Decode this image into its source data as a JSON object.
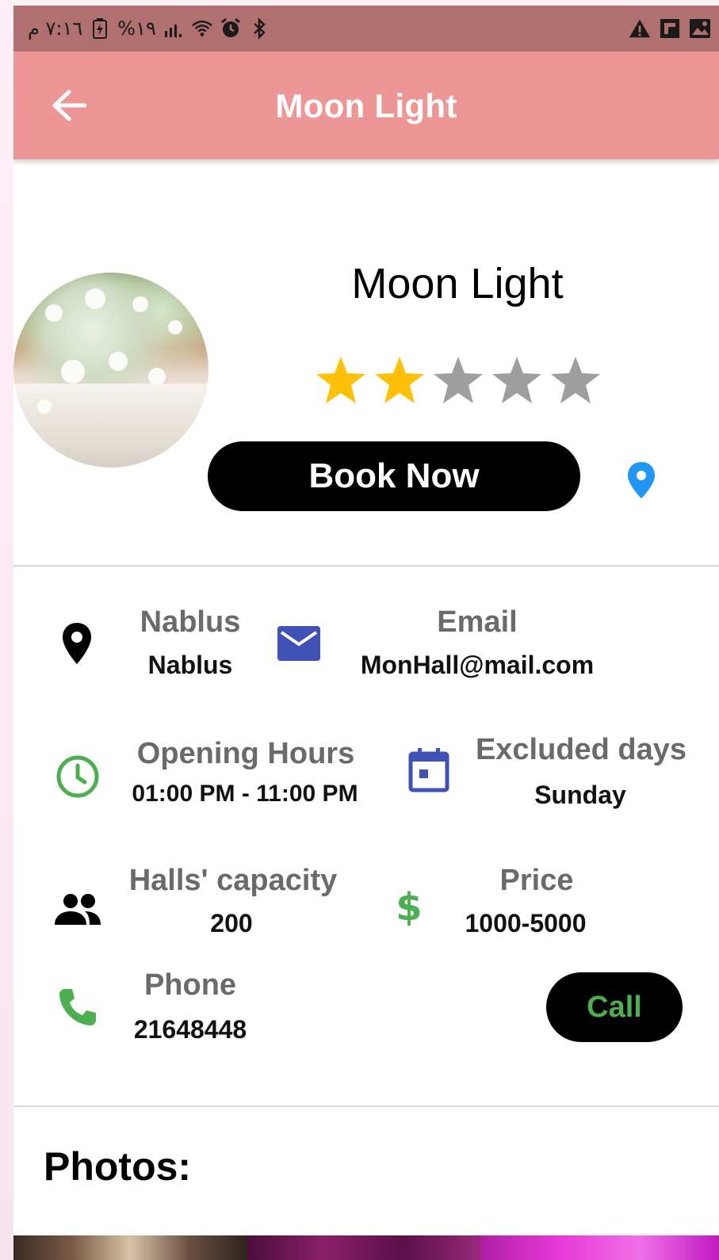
{
  "status_bar": {
    "time": "٧:١٦ م",
    "battery": "%١٩",
    "icons_left": [
      "battery-icon",
      "signal-icon",
      "wifi-icon",
      "alarm-icon",
      "bluetooth-icon"
    ],
    "icons_right": [
      "warning-icon",
      "flipboard-icon",
      "gallery-icon"
    ]
  },
  "app_bar": {
    "title": "Moon Light",
    "back_icon": "arrow-left-icon"
  },
  "hall": {
    "name": "Moon Light",
    "rating": 2,
    "rating_max": 5,
    "book_label": "Book Now"
  },
  "info": {
    "location": {
      "label": "Nablus",
      "value": "Nablus"
    },
    "email": {
      "label": "Email",
      "value": "MonHall@mail.com"
    },
    "opening_hours": {
      "label": "Opening Hours",
      "value": "01:00 PM - 11:00 PM"
    },
    "excluded_days": {
      "label": "Excluded days",
      "value": "Sunday"
    },
    "capacity": {
      "label": "Halls' capacity",
      "value": "200"
    },
    "price": {
      "label": "Price",
      "value": "1000-5000"
    },
    "phone": {
      "label": "Phone",
      "value": "21648448"
    },
    "call_label": "Call"
  },
  "photos": {
    "title": "Photos:"
  },
  "colors": {
    "status_bar": "#b07070",
    "app_bar": "#ec9696",
    "star_filled": "#ffc107",
    "star_empty": "#9e9e9e",
    "green": "#4caf50",
    "indigo": "#3f51b5",
    "blue_pin": "#2196f3"
  }
}
